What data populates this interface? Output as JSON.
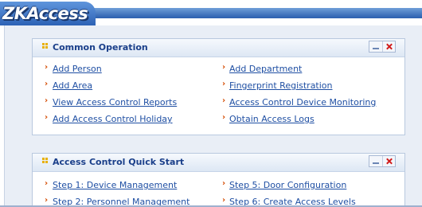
{
  "app": {
    "logo_text": "ZKAccess"
  },
  "common_operation": {
    "title": "Common Operation",
    "left_links": [
      "Add Person",
      "Add Area",
      "View Access Control Reports",
      "Add Access Control Holiday"
    ],
    "right_links": [
      "Add Department",
      "Fingerprint Registration",
      "Access Control Device Monitoring",
      "Obtain Access Logs"
    ]
  },
  "quick_start": {
    "title": "Access Control Quick Start",
    "left_links": [
      "Step 1: Device Management",
      "Step 2: Personnel Management"
    ],
    "right_links": [
      "Step 5: Door Configuration",
      "Step 6: Create Access Levels"
    ]
  },
  "colors": {
    "link": "#1f4fa3",
    "title": "#1a3f8a",
    "arrow": "#d44a00",
    "brand_blue": "#2f63b1"
  },
  "icons": {
    "panel_icon": "grid-dots-icon",
    "minimize": "minimize-icon",
    "close": "close-icon",
    "bullet": "chevron-right-icon"
  }
}
